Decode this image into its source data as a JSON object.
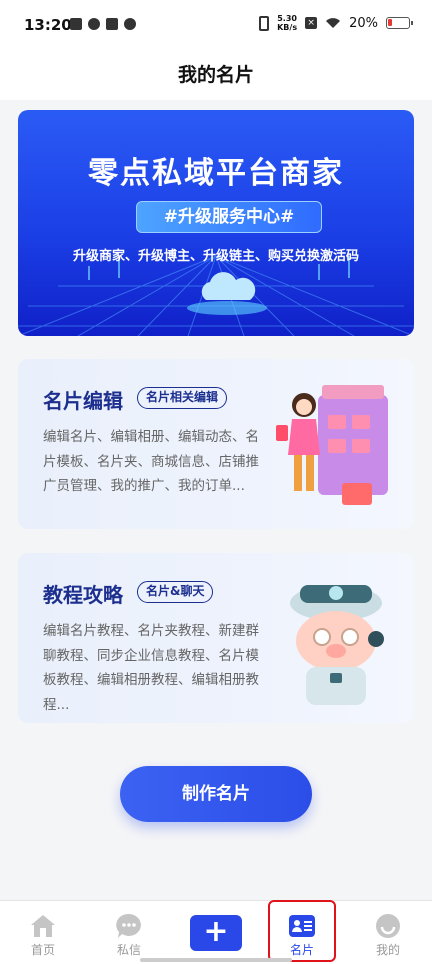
{
  "status_bar": {
    "time": "13:20",
    "speed_value": "5.30",
    "speed_unit": "KB/s",
    "battery": "20%"
  },
  "header": {
    "title": "我的名片"
  },
  "banner": {
    "title": "零点私域平台商家",
    "pill": "#升级服务中心#",
    "subtitle": "升级商家、升级博主、升级链主、购买兑换激活码"
  },
  "cards": [
    {
      "title": "名片编辑",
      "tag": "名片相关编辑",
      "description": "编辑名片、编辑相册、编辑动态、名片模板、名片夹、商城信息、店铺推广员管理、我的推广、我的订单..."
    },
    {
      "title": "教程攻略",
      "tag": "名片&聊天",
      "description": "编辑名片教程、名片夹教程、新建群聊教程、同步企业信息教程、名片模板教程、编辑相册教程、编辑相册教程..."
    }
  ],
  "make_button": {
    "label": "制作名片"
  },
  "bottom_nav": {
    "home": "首页",
    "messages": "私信",
    "add": "+",
    "card": "名片",
    "mine": "我的",
    "active": "card"
  },
  "colors": {
    "accent": "#2a48e8",
    "card_title": "#1c2f8f",
    "highlight": "#e0131b"
  }
}
